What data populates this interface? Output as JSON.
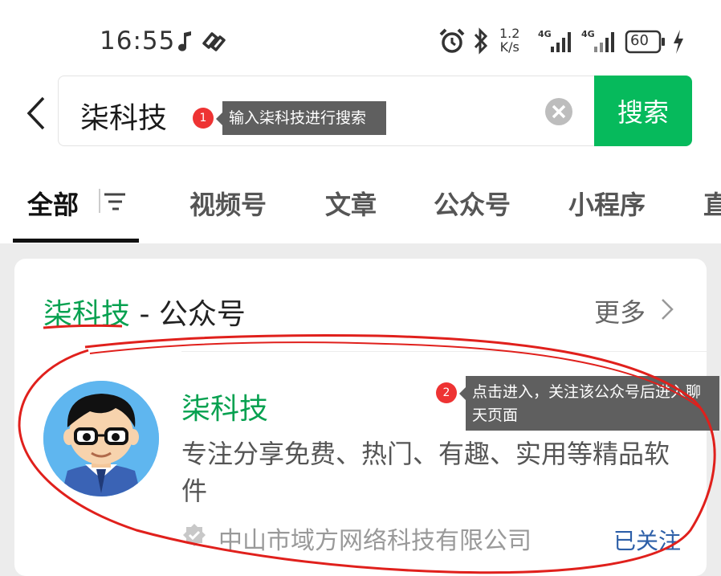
{
  "status_bar": {
    "time": "16:55",
    "net_speed_value": "1.2",
    "net_speed_unit": "K/s",
    "signal_1_label": "4G",
    "signal_2_label": "4G",
    "battery_level": "60",
    "icons": [
      "music-note-icon",
      "notification-icon",
      "alarm-icon",
      "bluetooth-icon",
      "signal-icon",
      "signal-icon",
      "battery-icon",
      "charging-icon"
    ]
  },
  "search": {
    "query": "柒科技",
    "button_label": "搜索"
  },
  "tabs": [
    {
      "label": "全部"
    },
    {
      "label": "视频号"
    },
    {
      "label": "文章"
    },
    {
      "label": "公众号"
    },
    {
      "label": "小程序"
    },
    {
      "label": "直"
    }
  ],
  "annotations": [
    {
      "number": "1",
      "text": "输入柒科技进行搜索"
    },
    {
      "number": "2",
      "text": "点击进入，关注该公众号后进入聊天页面"
    }
  ],
  "result_card": {
    "title_highlight": "柒科技",
    "title_suffix": " - 公众号",
    "more_label": "更多",
    "account": {
      "name": "柒科技",
      "description": "专注分享免费、热门、有趣、实用等精品软件",
      "company": "中山市域方网络科技有限公司",
      "follow_status": "已关注"
    }
  },
  "colors": {
    "accent_green": "#06ba5c",
    "highlight_green": "#07a150",
    "link_blue": "#2d5fa8",
    "annotation_red": "#ee3333",
    "ink_red": "#e0201c"
  }
}
